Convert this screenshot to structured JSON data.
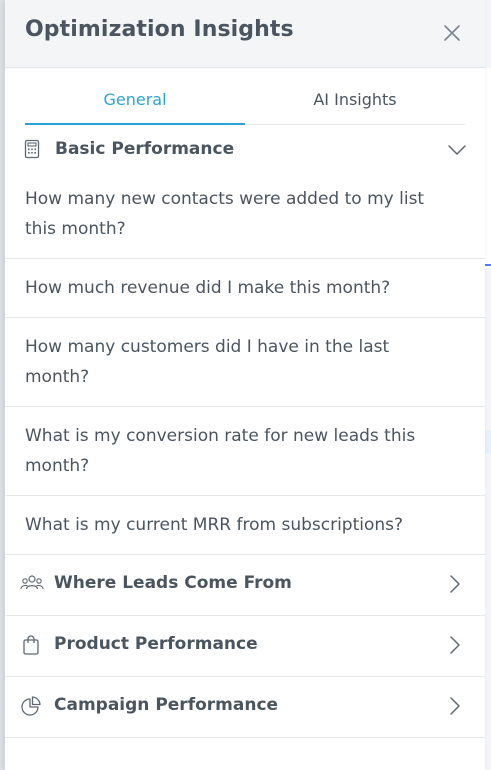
{
  "panel": {
    "title": "Optimization Insights",
    "close_icon": "close-icon"
  },
  "tabs": [
    {
      "label": "General",
      "active": true
    },
    {
      "label": "AI Insights",
      "active": false
    }
  ],
  "colors": {
    "accent": "#2ba3d8",
    "text": "#4a5560",
    "header_bg": "#f4f5f7"
  },
  "sections": {
    "basic": {
      "label": "Basic Performance",
      "icon": "calculator-icon",
      "expanded": true,
      "questions": [
        "How many new contacts were added to my list this month?",
        "How much revenue did I make this month?",
        "How many customers did I have in the last month?",
        "What is my conversion rate for new leads this month?",
        "What is my current MRR from subscriptions?"
      ]
    },
    "leads": {
      "label": "Where Leads Come From",
      "icon": "people-icon",
      "expanded": false
    },
    "product": {
      "label": "Product Performance",
      "icon": "shopping-bag-icon",
      "expanded": false
    },
    "campaign": {
      "label": "Campaign Performance",
      "icon": "pie-chart-icon",
      "expanded": false
    }
  }
}
